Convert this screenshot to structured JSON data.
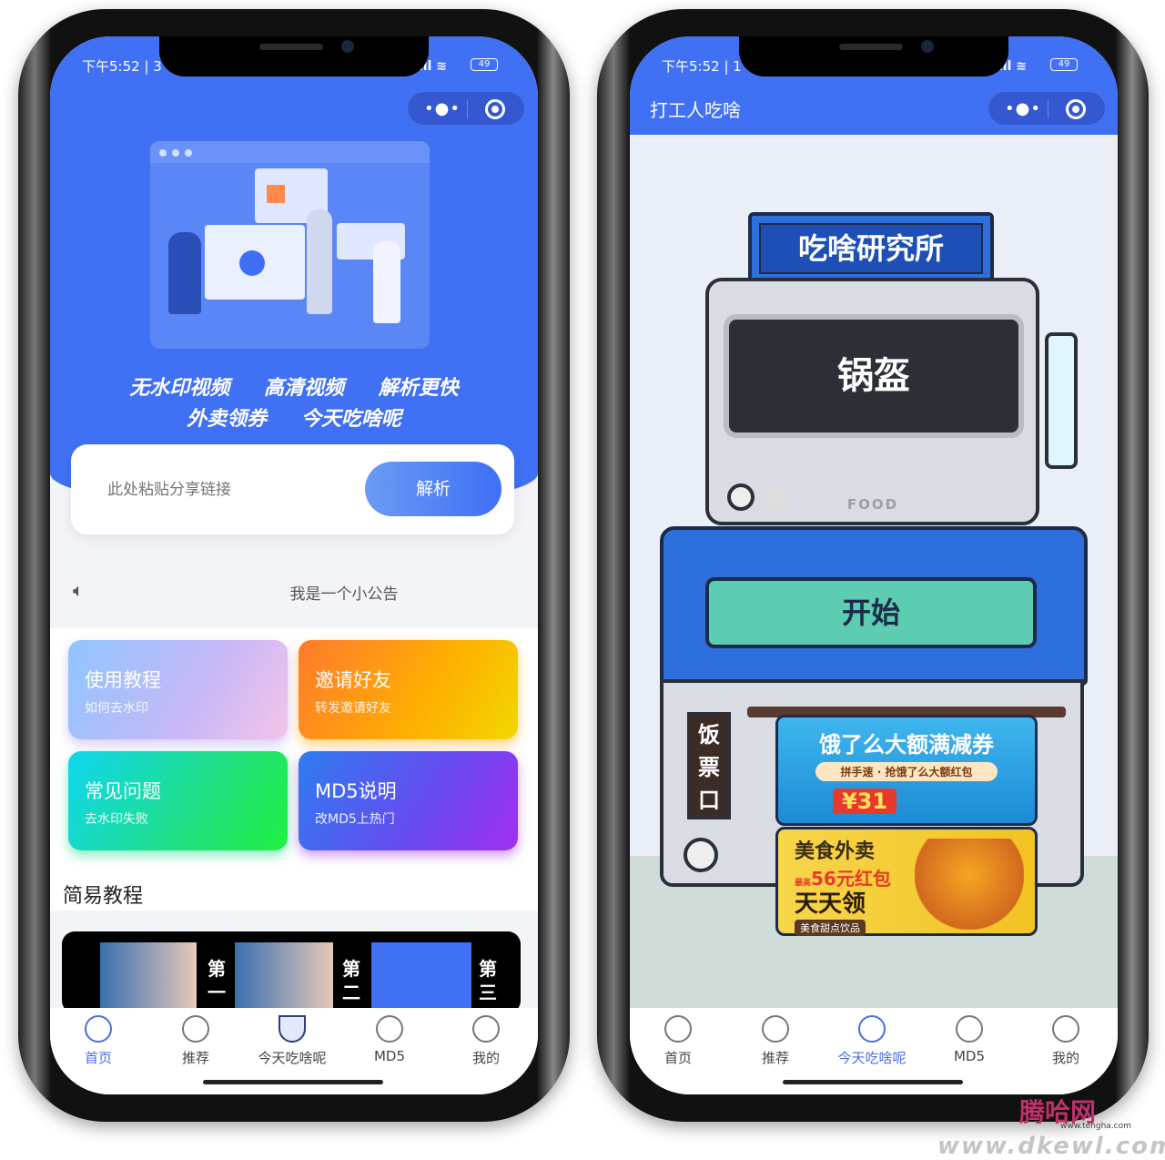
{
  "left_phone": {
    "status": {
      "time": "下午5:52 | 3",
      "battery": "49"
    },
    "capsule": {
      "more_icon": "more-dots-icon",
      "close_icon": "target-circle-icon"
    },
    "slogan": {
      "line1": [
        "无水印视频",
        "高清视频",
        "解析更快"
      ],
      "line2": [
        "外卖领券",
        "今天吃啥呢"
      ]
    },
    "search": {
      "placeholder": "此处粘贴分享链接",
      "value": "",
      "button": "解析"
    },
    "notice": {
      "icon": "speaker-icon",
      "text": "我是一个小公告"
    },
    "cards": [
      {
        "title": "使用教程",
        "subtitle": "如何去水印"
      },
      {
        "title": "邀请好友",
        "subtitle": "转发邀请好友"
      },
      {
        "title": "常见问题",
        "subtitle": "去水印失败"
      },
      {
        "title": "MD5说明",
        "subtitle": "改MD5上热门"
      }
    ],
    "tutorial": {
      "heading": "简易教程",
      "steps": [
        "第一",
        "第二",
        "第三"
      ]
    },
    "tabs": [
      {
        "label": "首页",
        "icon": "compass-icon",
        "active": true
      },
      {
        "label": "推荐",
        "icon": "snowflake-icon"
      },
      {
        "label": "今天吃啥呢",
        "icon": "rice-bowl-icon"
      },
      {
        "label": "MD5",
        "icon": "ring-icon"
      },
      {
        "label": "我的",
        "icon": "smile-icon"
      }
    ]
  },
  "right_phone": {
    "status": {
      "time": "下午5:52 | 1",
      "battery": "49"
    },
    "header": {
      "title": "打工人吃啥"
    },
    "machine": {
      "sign": "吃啥研究所",
      "result": "锅盔",
      "brand": "FOOD",
      "start_button": "开始",
      "ticket_label": "饭票口"
    },
    "ads": [
      {
        "title": "饿了么大额满减券",
        "subtitle": "拼手速 · 抢饿了么大额红包",
        "amount": "¥31"
      },
      {
        "title": "美食外卖",
        "line2": "56元红包",
        "line2_prefix": "最高",
        "line3": "天天领",
        "tag": "美食甜点饮品"
      }
    ],
    "tabs": [
      {
        "label": "首页",
        "icon": "compass-icon"
      },
      {
        "label": "推荐",
        "icon": "snowflake-icon"
      },
      {
        "label": "今天吃啥呢",
        "icon": "target-icon",
        "active": true
      },
      {
        "label": "MD5",
        "icon": "ring-icon"
      },
      {
        "label": "我的",
        "icon": "smile-icon"
      }
    ]
  },
  "watermark": {
    "text1": "腾哈网",
    "text2": "www.tengha.com",
    "text3": "www.dkewl.com"
  },
  "colors": {
    "primary": "#3f6ff5",
    "tab_active": "#4a6ee0",
    "start_green": "#5ccdb0",
    "machine_blue": "#2f6fdc"
  }
}
